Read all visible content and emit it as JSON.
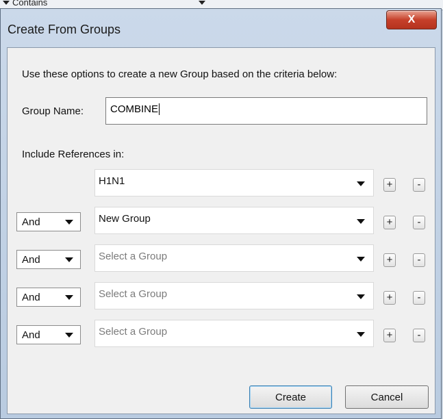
{
  "background_app": {
    "visible_text": "Contains"
  },
  "dialog": {
    "title": "Create From Groups",
    "close_glyph": "X",
    "instructions": "Use these options to create a new Group based on the criteria below:",
    "group_name": {
      "label": "Group Name:",
      "value": "COMBINE"
    },
    "include_label": "Include References in:",
    "rows": [
      {
        "operator": null,
        "group": "H1N1",
        "placeholder": false
      },
      {
        "operator": "And",
        "group": "New Group",
        "placeholder": false
      },
      {
        "operator": "And",
        "group": "Select a Group",
        "placeholder": true
      },
      {
        "operator": "And",
        "group": "Select a Group",
        "placeholder": true
      },
      {
        "operator": "And",
        "group": "Select a Group",
        "placeholder": true
      }
    ],
    "plus_label": "+",
    "minus_label": "-",
    "buttons": {
      "create": "Create",
      "cancel": "Cancel"
    }
  },
  "colors": {
    "close_button": "#c6402a",
    "default_button_border": "#3c7fb1",
    "placeholder_text": "#7b7b7b"
  }
}
